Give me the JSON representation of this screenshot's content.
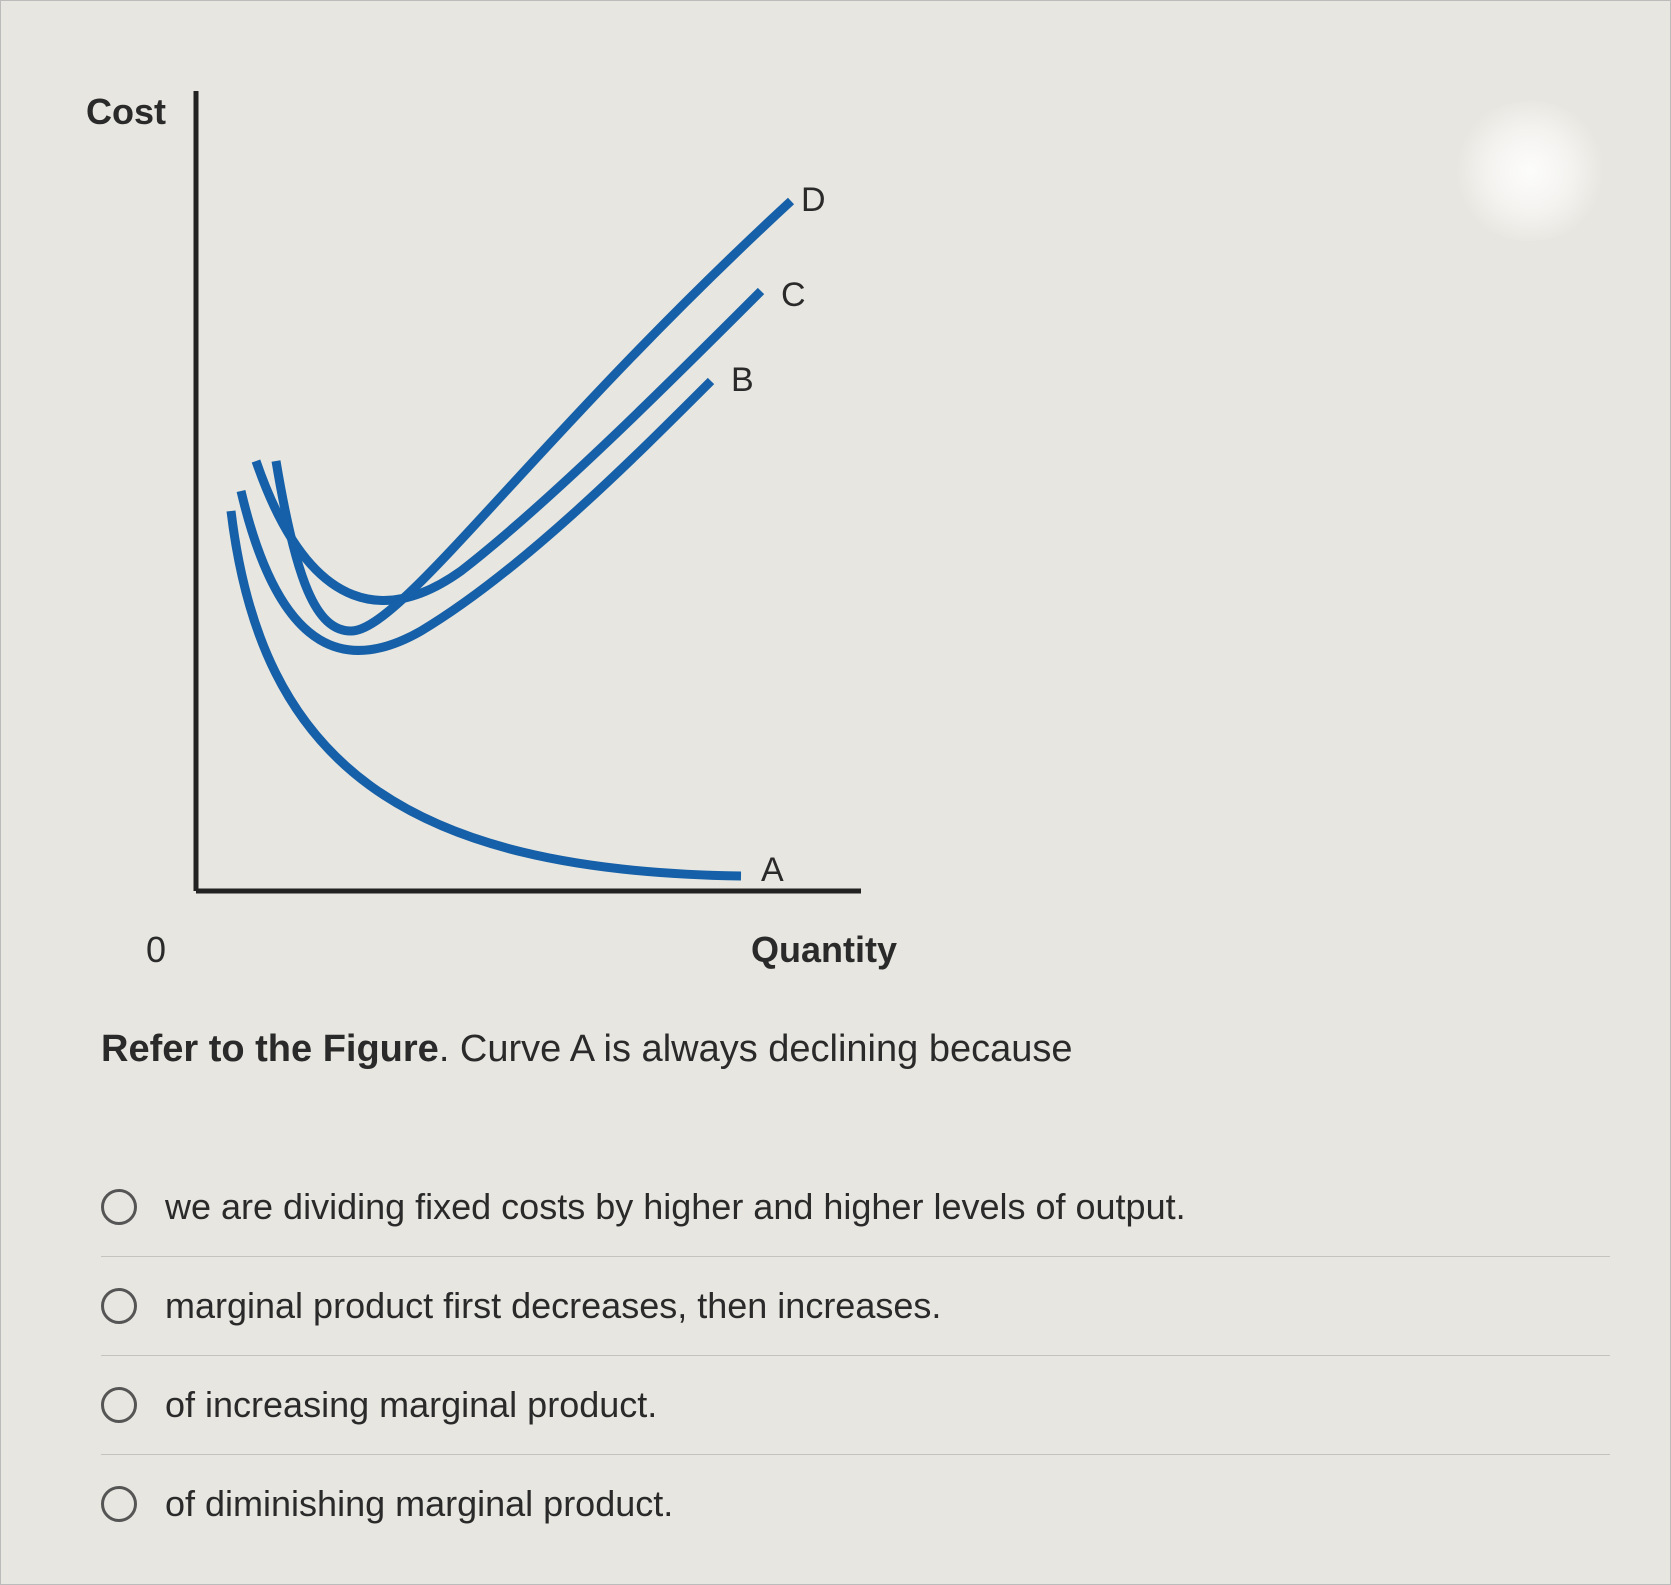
{
  "chart_data": {
    "type": "line",
    "title": "",
    "xlabel": "Quantity",
    "ylabel": "Cost",
    "origin": "0",
    "series": [
      {
        "name": "A",
        "description": "Always declining toward x-axis (AFC)"
      },
      {
        "name": "B",
        "description": "U-shaped, lowest at low quantity then rising (AVC)"
      },
      {
        "name": "C",
        "description": "U-shaped above B, rising (ATC)"
      },
      {
        "name": "D",
        "description": "Steep U-shape intersecting B and C at minima (MC)"
      }
    ],
    "curve_labels": {
      "A": "A",
      "B": "B",
      "C": "C",
      "D": "D"
    }
  },
  "question": {
    "prefix": "Refer to the Figure",
    "body": ". Curve A is always declining because"
  },
  "options": [
    "we are dividing fixed costs by higher and higher levels of output.",
    "marginal product first decreases, then increases.",
    "of increasing marginal product.",
    "of diminishing marginal product."
  ]
}
